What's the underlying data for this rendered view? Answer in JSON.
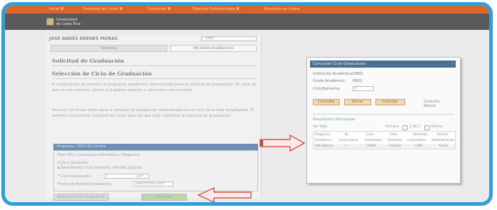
{
  "app": {
    "nav_items": [
      "Inicio ▼",
      "Procesos en Línea ▼",
      "Consultas ▼",
      "Trámites Estudiantiles ▼",
      "Servicios en Línea"
    ],
    "org_name_line1": "Universidad",
    "org_name_line2": "de Costa Rica"
  },
  "student": {
    "name": "JOSE ANDÉS BRENES MORAS",
    "selector_value": "Plan"
  },
  "tabs": [
    "Servicios",
    "Mis Datos Académicos"
  ],
  "main": {
    "heading": "Solicitud de Graduación",
    "subheading": "Selección de Ciclo de Graduación",
    "paragraph1": "A continuación se muestra el programa académico seleccionado para la solicitud de graduación. En caso de que no sea correcto, vuelva a la página anterior y seleccione uno correcto.",
    "paragraph2": "Para ver y/o llenar datos para la solicitud de graduación seleccionada en un ciclo de la lista desplegable. El sistema únicamente mostrará los ciclos para los que esté habilitado la solicitud de graduación.",
    "program_bar": "Programa: 7020-08 Carrera",
    "program_line1": "Plan: 001 Licenciatura Informática / Programa:",
    "program_line2": "Ciclo o Semestre:",
    "program_line3": "▪ Bachillerato: Ciclo Ordinario (Periodo Lectivo)",
    "cycle_label": "* Ciclo Graduación:",
    "cycle_value": "1",
    "cycle_select_value": "▾",
    "period_label": "Fecha y/o Periodo Graduación:",
    "period_value": "Seleccione Ciclo",
    "back_button": "Selección Ciclo Graduación",
    "next_button": "Continuar"
  },
  "popup": {
    "title": "Consultar Ciclo Graduación",
    "close": "x",
    "field1_label": "Institución Académica:",
    "field1_value": "UNED",
    "field2_label": "Grado Académico:",
    "field2_value": "PREG",
    "field3_label": "Ciclo/Semestre:",
    "field3_value": "▾",
    "buttons": [
      "Consultar",
      "Borrar",
      "Cancelar"
    ],
    "extra_label": "Consulta",
    "extra_label2": "Básica",
    "results_title": "Resultados Búsqueda",
    "view_all": "Ver Todo",
    "filter1": "Primero",
    "filter2": "1 de 1",
    "filter3": "Último",
    "columns": [
      "Programa",
      "Nr.",
      "Ciclo",
      "Fase",
      "Semestre",
      "Estado"
    ],
    "row1": [
      "Académico",
      "Licenciatura",
      "Informática",
      "Semestre",
      "Licenciatura",
      "Administración"
    ],
    "row2": [
      "UNI (Básico)",
      "1",
      "C0083",
      "Profesor",
      "C006",
      "Activo"
    ]
  },
  "colors": {
    "accent_blue": "#2d9fd9",
    "nav_orange": "#d9672c",
    "arrow_red": "#d33a2f"
  },
  "icons": [
    "university-logo-icon",
    "arrow-right-icon",
    "arrow-left-icon",
    "close-icon",
    "chevron-down-icon"
  ]
}
